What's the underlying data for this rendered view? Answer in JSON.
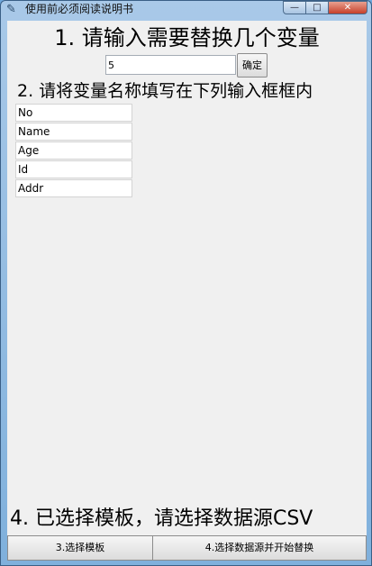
{
  "window": {
    "title": "使用前必须阅读说明书",
    "icon": "feather-icon",
    "controls": {
      "minimize": "—",
      "maximize": "□",
      "close": "✕"
    }
  },
  "section1": {
    "heading": "1. 请输入需要替换几个变量",
    "count_value": "5",
    "confirm_label": "确定"
  },
  "section2": {
    "heading": "2. 请将变量名称填写在下列输入框框内",
    "fields": [
      "No",
      "Name",
      "Age",
      "Id",
      "Addr"
    ]
  },
  "section4": {
    "status_text": "4. 已选择模板，请选择数据源CSV"
  },
  "buttons": {
    "select_template": "3.选择模板",
    "select_source": "4.选择数据源并开始替换"
  }
}
